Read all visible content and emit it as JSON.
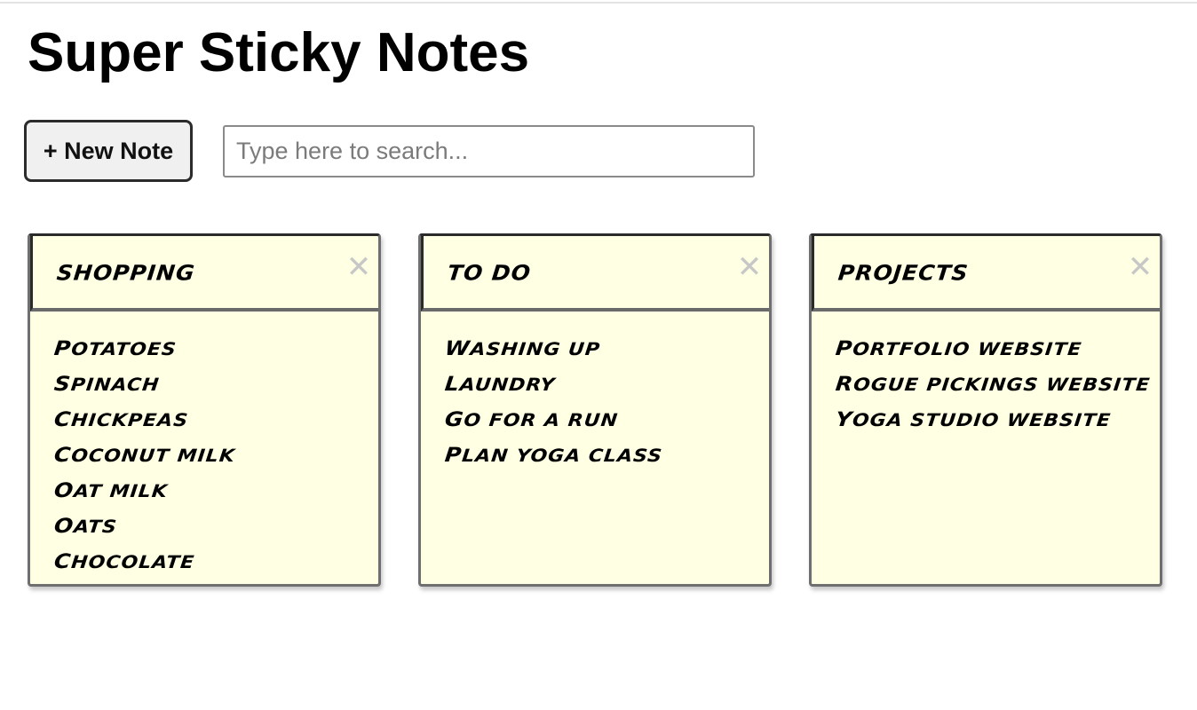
{
  "app": {
    "title": "Super Sticky Notes"
  },
  "toolbar": {
    "new_note_label": "+ New Note",
    "search_placeholder": "Type here to search...",
    "search_value": ""
  },
  "notes": [
    {
      "title": "Shopping",
      "items": [
        "Potatoes",
        "spinach",
        "chickpeas",
        "coconut milk",
        "oat milk",
        "oats",
        "chocolate"
      ]
    },
    {
      "title": "To Do",
      "items": [
        "washing up",
        "laundry",
        "go for a run",
        "plan yoga class"
      ]
    },
    {
      "title": "Projects",
      "items": [
        "portfolio website",
        "rogue pickings website",
        "yoga studio website"
      ]
    }
  ],
  "icons": {
    "close": "close-icon"
  },
  "colors": {
    "note_background": "#ffffe4",
    "close_icon": "#c7c7c7"
  }
}
